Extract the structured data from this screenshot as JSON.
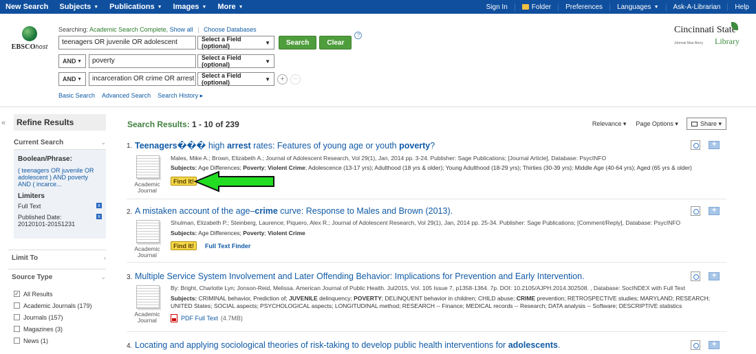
{
  "topbar": {
    "left": [
      {
        "label": "New Search",
        "caret": false
      },
      {
        "label": "Subjects",
        "caret": true
      },
      {
        "label": "Publications",
        "caret": true
      },
      {
        "label": "Images",
        "caret": true
      },
      {
        "label": "More",
        "caret": true
      }
    ],
    "right": [
      "Sign In",
      "Folder",
      "Preferences",
      "Languages",
      "Ask-A-Librarian",
      "Help"
    ]
  },
  "search": {
    "searching_prefix": "Searching:",
    "database": "Academic Search Complete,",
    "show_all": "Show all",
    "choose_db": "Choose Databases",
    "rows": [
      {
        "op": "",
        "query": "teenagers OR juvenile OR adolescent",
        "field": "Select a Field (optional)"
      },
      {
        "op": "AND",
        "query": "poverty",
        "field": "Select a Field (optional)"
      },
      {
        "op": "AND",
        "query": "incarceration OR crime OR arrest",
        "field": "Select a Field (optional)"
      }
    ],
    "search_btn": "Search",
    "clear_btn": "Clear",
    "links": [
      "Basic Search",
      "Advanced Search",
      "Search History ▸"
    ]
  },
  "logo": {
    "ebsco": "EBSCO",
    "host": "host"
  },
  "library": {
    "line1": "Cincinnati State",
    "small": "Johnnie Mae Berry",
    "line2": "Library"
  },
  "left": {
    "refine": "Refine Results",
    "current_search": "Current Search",
    "boolean_label": "Boolean/Phrase:",
    "boolean_text": "( teenagers OR juvenile OR adolescent ) AND poverty AND ( incarce...",
    "limiters_label": "Limiters",
    "limiter1": "Full Text",
    "limiter2a": "Published Date:",
    "limiter2b": "20120101-20151231",
    "limit_to": "Limit To",
    "source_type": "Source Type",
    "sources": [
      {
        "label": "All Results",
        "checked": true
      },
      {
        "label": "Academic Journals (179)",
        "checked": false
      },
      {
        "label": "Journals (157)",
        "checked": false
      },
      {
        "label": "Magazines (3)",
        "checked": false
      },
      {
        "label": "News (1)",
        "checked": false
      }
    ]
  },
  "main": {
    "results_label": "Search Results:",
    "results_range": "1 - 10 of 239",
    "sort": "Relevance ▾",
    "page_options": "Page Options ▾",
    "share": "Share ▾",
    "results": [
      {
        "num": "1.",
        "title_html": "<b>Teenagers���</b> high <b>arrest</b> rates: Features of young age or youth <b>poverty</b>?",
        "meta": "Males, Mike A.; Brown, Elizabeth A.; Journal of Adolescent Research, Vol 29(1), Jan, 2014 pp. 3-24. Publisher: Sage Publications; [Journal Article], Database: PsycINFO",
        "subjects_label": "Subjects:",
        "subjects": "Age Differences; Poverty; Violent Crime; Adolescence (13-17 yrs); Adulthood (18 yrs & older); Young Adulthood (18-29 yrs); Thirties (30-39 yrs); Middle Age (40-64 yrs); Aged (65 yrs & older)",
        "doctype": "Academic Journal",
        "findit": "Find It!"
      },
      {
        "num": "2.",
        "title_html": "A mistaken account of the age–<b>crime</b> curve: Response to Males and Brown (2013).",
        "meta": "Shulman, Elizabeth P.; Steinberg, Laurence; Piquero, Alex R.; Journal of Adolescent Research, Vol 29(1), Jan, 2014 pp. 25-34. Publisher: Sage Publications; [Comment/Reply], Database: PsycINFO",
        "subjects_label": "Subjects:",
        "subjects": "Age Differences; Poverty; Violent Crime",
        "doctype": "Academic Journal",
        "findit": "Find It!",
        "fulltext_finder": "Full Text Finder"
      },
      {
        "num": "3.",
        "title_html": "Multiple Service System Involvement and Later Offending Behavior: Implications for Prevention and Early Intervention.",
        "meta": "By: Bright, Charlotte Lyn; Jonson-Reid, Melissa. American Journal of Public Health. Jul2015, Vol. 105 Issue 7, p1358-1364. 7p. DOI: 10.2105/AJPH.2014.302508. , Database: SocINDEX with Full Text",
        "subjects_label": "Subjects:",
        "subjects": "CRIMINAL behavior, Prediction of; JUVENILE delinquency; POVERTY; DELINQUENT behavior in children; CHILD abuse; CRIME prevention; RETROSPECTIVE studies; MARYLAND; RESEARCH; UNITED States; SOCIAL aspects; PSYCHOLOGICAL aspects; LONGITUDINAL method; RESEARCH -- Finance; MEDICAL records -- Research; DATA analysis -- Software; DESCRIPTIVE statistics",
        "doctype": "Academic Journal",
        "pdf": "PDF Full Text",
        "pdf_size": "(4.7MB)"
      },
      {
        "num": "4.",
        "title_html": "Locating and applying sociological theories of risk-taking to develop public health interventions for <b>adolescents</b>."
      }
    ]
  },
  "colors": {
    "topbar": "#0f4f9e",
    "link": "#105aa5",
    "green_btn": "#4f9e3d",
    "arrow": "#22dd22"
  }
}
